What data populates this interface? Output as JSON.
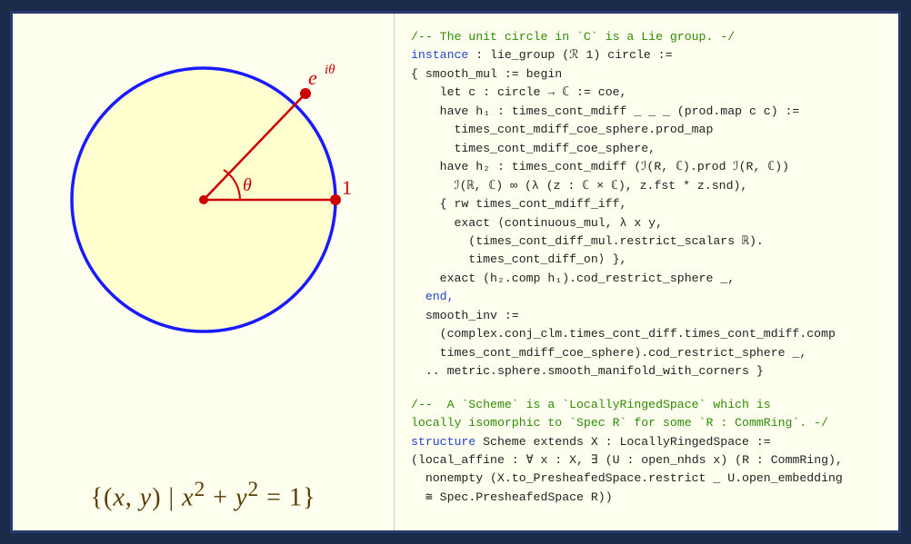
{
  "left": {
    "formula": "{(x, y) | x² + y² = 1}"
  },
  "right": {
    "block1": [
      {
        "type": "comment",
        "text": "/-- The unit circle in `C` is a Lie group. -/"
      },
      {
        "type": "keyword",
        "text": "instance"
      },
      {
        "type": "default",
        "text": " : lie_group (ℛ 1) circle :="
      },
      {
        "type": "default",
        "text": "{ smooth_mul := begin"
      },
      {
        "type": "default",
        "text": "    let c : circle → ℂ := coe,"
      },
      {
        "type": "default",
        "text": "    have h₁ : times_cont_mdiff _ _ _ (prod.map c c) :="
      },
      {
        "type": "default",
        "text": "      times_cont_mdiff_coe_sphere.prod_map"
      },
      {
        "type": "default",
        "text": "      times_cont_mdiff_coe_sphere,"
      },
      {
        "type": "default",
        "text": "    have h₂ : times_cont_mdiff (ℐ(R, ℂ).prod ℐ(R, ℂ))"
      },
      {
        "type": "default",
        "text": "      ℐ(ℝ, ℂ) ∞ (λ (z : ℂ × ℂ), z.fst * z.snd),"
      },
      {
        "type": "default",
        "text": "    { rw times_cont_mdiff_iff,"
      },
      {
        "type": "default",
        "text": "      exact ⟨continuous_mul, λ x y,"
      },
      {
        "type": "default",
        "text": "        (times_cont_diff_mul.restrict_scalars ℝ)."
      },
      {
        "type": "default",
        "text": "        times_cont_diff_on⟩ },"
      },
      {
        "type": "default",
        "text": "    exact (h₂.comp h₁).cod_restrict_sphere _,"
      },
      {
        "type": "keyword2",
        "text": "  end,"
      },
      {
        "type": "default",
        "text": "  smooth_inv :="
      },
      {
        "type": "default",
        "text": "    (complex.conj_clm.times_cont_diff.times_cont_mdiff.comp"
      },
      {
        "type": "default",
        "text": "    times_cont_mdiff_coe_sphere).cod_restrict_sphere _,"
      },
      {
        "type": "default",
        "text": "  .. metric.sphere.smooth_manifold_with_corners }"
      }
    ],
    "block2": [
      {
        "type": "comment",
        "text": "/--  A `Scheme` is a `LocallyRingedSpace` which is"
      },
      {
        "type": "comment",
        "text": "locally isomorphic to `Spec R` for some `R : CommRing`. -/"
      },
      {
        "type": "keyword",
        "text": "structure"
      },
      {
        "type": "default",
        "text": " Scheme extends X : LocallyRingedSpace :="
      },
      {
        "type": "default",
        "text": "(local_affine : ∀ x : X, ∃ (U : open_nhds x) (R : CommRing),"
      },
      {
        "type": "default",
        "text": "  nonempty (X.to_PresheafedSpace.restrict _ U.open_embedding"
      },
      {
        "type": "default",
        "text": "  ≅ Spec.PresheafedSpace R))"
      }
    ]
  }
}
